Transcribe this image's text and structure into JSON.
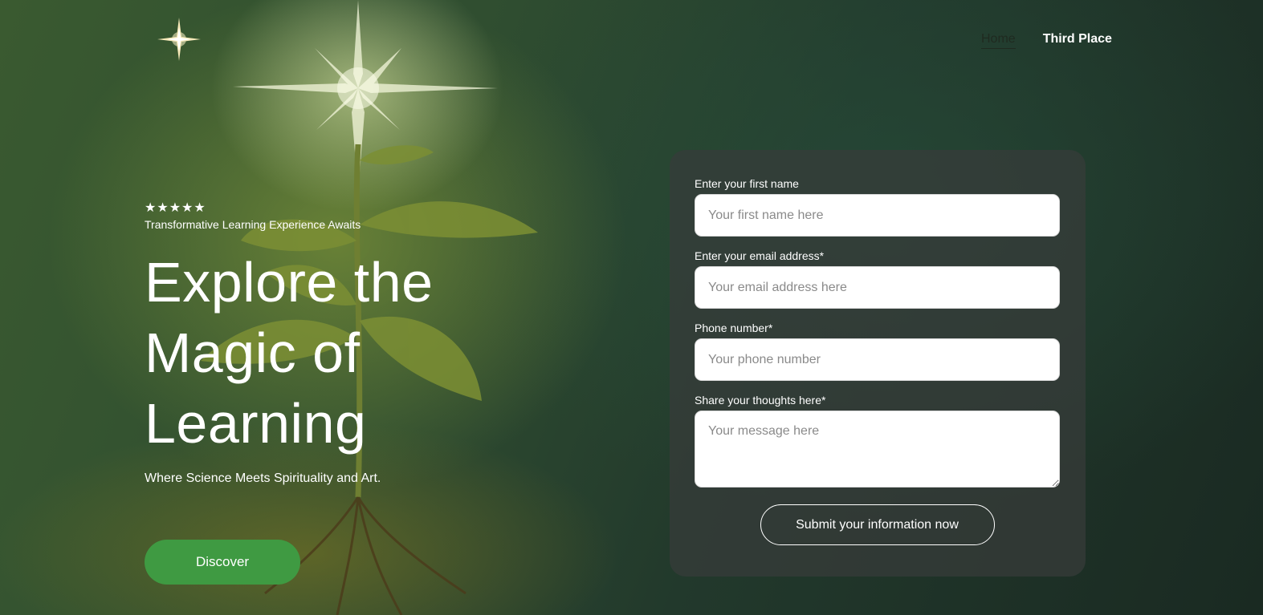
{
  "nav": {
    "items": [
      {
        "label": "Home"
      },
      {
        "label": "Third Place"
      }
    ]
  },
  "hero": {
    "rating_stars": "★★★★★",
    "tagline": "Transformative Learning Experience Awaits",
    "headline_line1": "Explore the",
    "headline_line2": "Magic of",
    "headline_line3": "Learning",
    "subline": "Where Science Meets Spirituality and Art.",
    "cta_label": "Discover"
  },
  "form": {
    "first_name": {
      "label": "Enter your first name",
      "placeholder": "Your first name here"
    },
    "email": {
      "label": "Enter your email address*",
      "placeholder": "Your email address here"
    },
    "phone": {
      "label": "Phone number*",
      "placeholder": "Your phone number"
    },
    "message": {
      "label": "Share your thoughts here*",
      "placeholder": "Your message here"
    },
    "submit_label": "Submit your information now"
  },
  "colors": {
    "cta_green": "#3f9a42",
    "card_bg": "#373c3a"
  },
  "icons": {
    "logo": "four-point-star-icon"
  }
}
